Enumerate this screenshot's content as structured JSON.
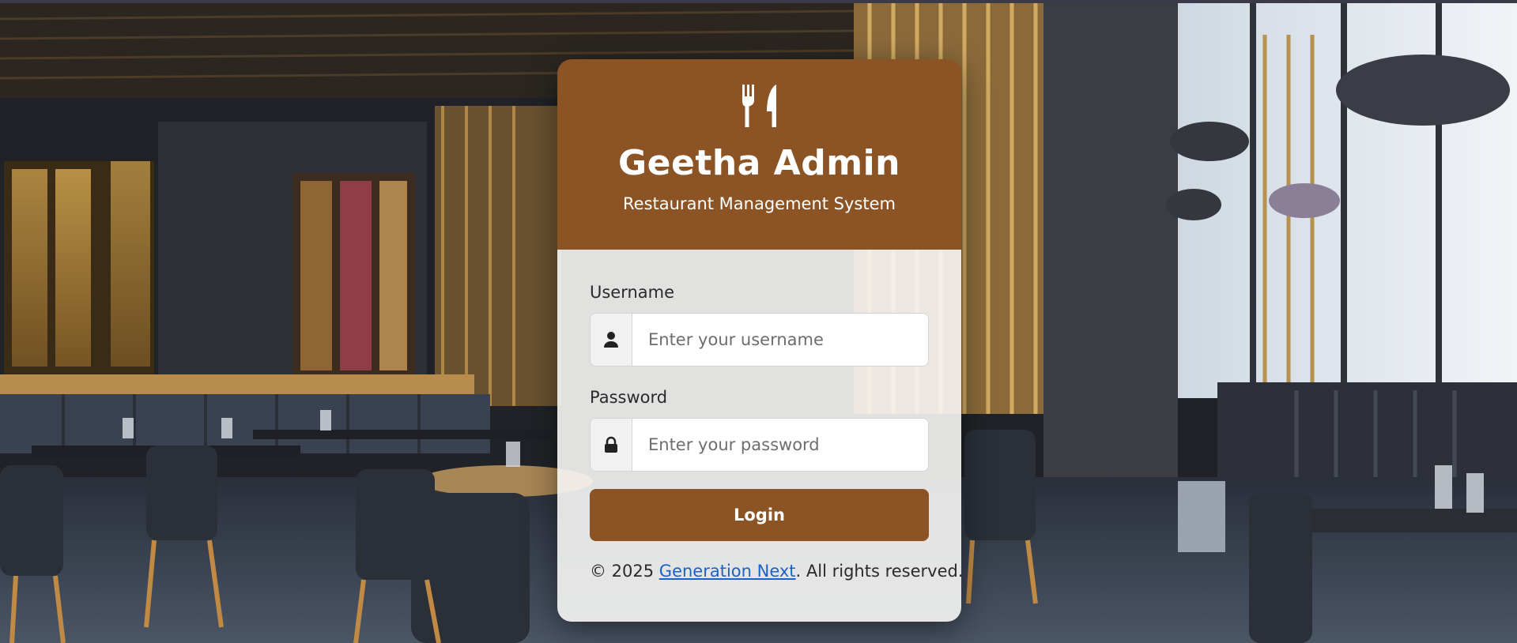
{
  "brand": {
    "title": "Geetha Admin",
    "subtitle": "Restaurant Management System",
    "logo_icon": "utensils-icon",
    "header_color": "#8c5424"
  },
  "form": {
    "username": {
      "label": "Username",
      "placeholder": "Enter your username",
      "value": "",
      "icon": "user-icon"
    },
    "password": {
      "label": "Password",
      "placeholder": "Enter your password",
      "value": "",
      "icon": "lock-icon"
    },
    "submit_label": "Login",
    "button_color": "#8c5424"
  },
  "footer": {
    "prefix": "© 2025 ",
    "link_text": "Generation Next",
    "suffix": ". All rights reserved.",
    "link_color": "#1a62c9"
  },
  "background": {
    "scene": "restaurant-interior"
  }
}
